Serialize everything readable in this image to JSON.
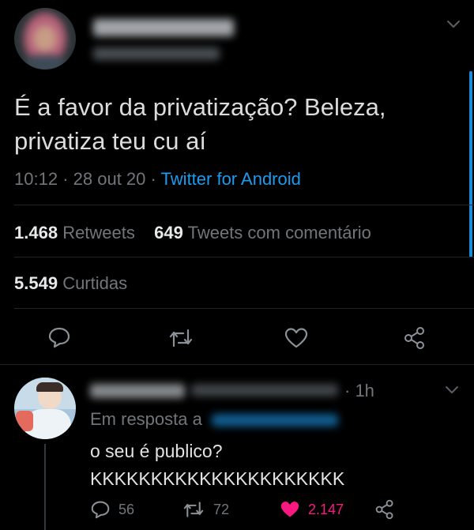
{
  "colors": {
    "background": "#000000",
    "text": "#d9d9d9",
    "muted": "#71767b",
    "link": "#1d9bf0",
    "like": "#f91880",
    "divider": "#1e2326",
    "scroll": "#1d9bf0"
  },
  "tweet": {
    "text_line1": "É a favor da privatização? Beleza,",
    "text_line2": "privatiza teu cu aí",
    "time": "10:12",
    "sep1": "·",
    "date": "28 out 20",
    "sep2": "·",
    "client": "Twitter for Android",
    "retweets_count": "1.468",
    "retweets_label": "Retweets",
    "quotes_count": "649",
    "quotes_label": "Tweets com comentário",
    "likes_count": "5.549",
    "likes_label": "Curtidas",
    "icons": [
      "reply-icon",
      "retweet-icon",
      "like-icon",
      "share-icon"
    ]
  },
  "reply": {
    "age": "· 1h",
    "replying_to_label": "Em resposta a",
    "text_line1": "o seu é publico?",
    "text_line2": "KKKKKKKKKKKKKKKKKKKKK",
    "replies_count": "56",
    "retweets_count": "72",
    "likes_count": "2.147",
    "icons": [
      "reply-icon",
      "retweet-icon",
      "liked-heart-icon",
      "share-icon"
    ]
  }
}
